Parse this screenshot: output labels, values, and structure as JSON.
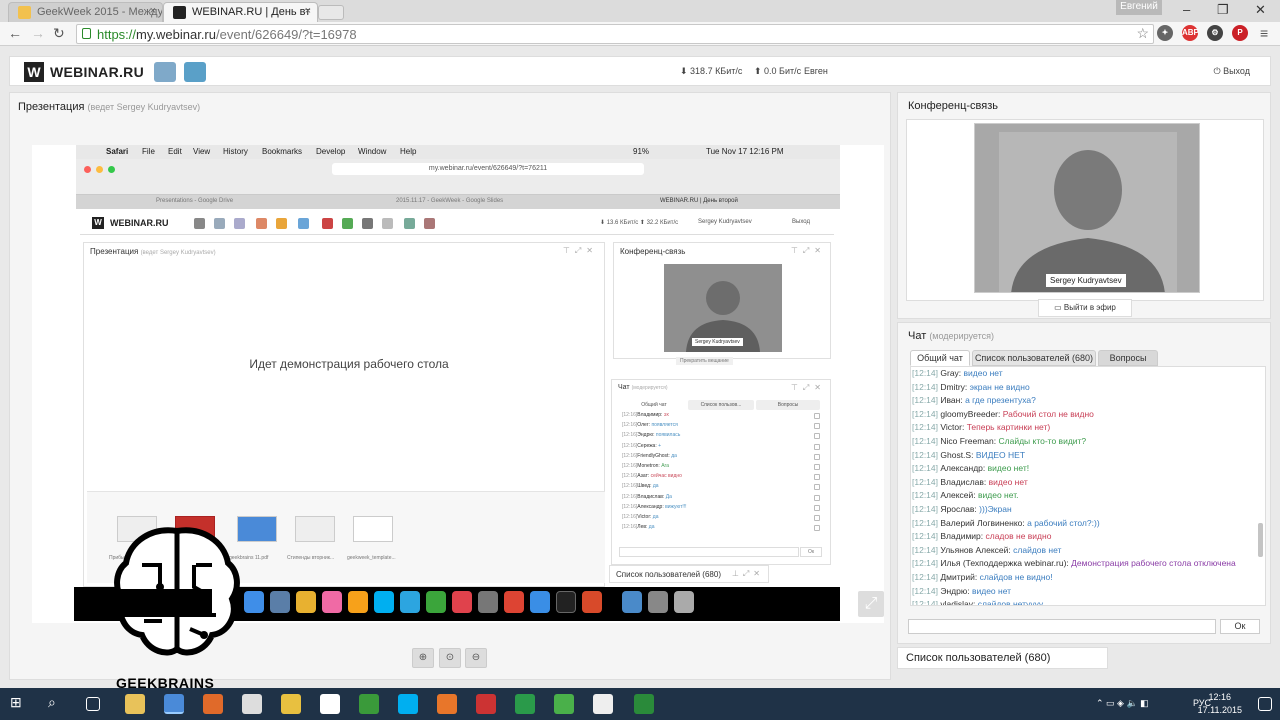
{
  "browser": {
    "tabs": [
      {
        "title": "GeekWeek 2015 - Между",
        "active": false
      },
      {
        "title": "WEBINAR.RU | День вт",
        "active": true
      }
    ],
    "user_badge": "Евгений",
    "url_scheme": "https://",
    "url_host": "my.webinar.ru",
    "url_path": "/event/626649/?t=16978"
  },
  "header": {
    "logo_text": "WEBINAR.RU",
    "download": "318.7 КБит/с",
    "upload": "0.0 Бит/с",
    "user": "Евген",
    "logout": "Выход"
  },
  "presentation": {
    "title": "Презентация",
    "subtitle": "(ведет Sergey Kudryavtsev)"
  },
  "inner": {
    "mac_menu": [
      "Safari",
      "File",
      "Edit",
      "View",
      "History",
      "Bookmarks",
      "Develop",
      "Window",
      "Help"
    ],
    "mac_status": "91%",
    "mac_clock": "Tue Nov 17  12:16 PM",
    "url": "my.webinar.ru/event/626649/?t=76211",
    "tabs": [
      "Presentations - Google Drive",
      "2015.11.17 - GeekWeek - Google Slides",
      "WEBINAR.RU | День второй"
    ],
    "logo_text": "WEBINAR.RU",
    "stats": "⬇ 13.6 КБит/с  ⬆ 32.2 КБит/с",
    "user": "Sergey Kudryavtsev",
    "logout": "Выход",
    "pres_title": "Презентация",
    "pres_sub": "(ведет Sergey Kudryavtsev)",
    "pres_msg": "Идет демонстрация рабочего стола",
    "thumbs": [
      "Прибыль...",
      "",
      "geekbrains 11.pdf",
      "Стипенды вторник...",
      "geekweek_template..."
    ],
    "conf_title": "Конференц-связь",
    "conf_name": "Sergey Kudryavtsev",
    "conf_stop": "Прекратить вещание",
    "chat_title": "Чат",
    "chat_sub": "(модерируется)",
    "chat_tabs": [
      "Общий чат",
      "Список пользов...",
      "Вопросы"
    ],
    "chat_lines": [
      {
        "t": "[12:16]",
        "a": "Владимир:",
        "m": "эх",
        "c": "red"
      },
      {
        "t": "[12:16]",
        "a": "Олег:",
        "m": "появляется",
        "c": ""
      },
      {
        "t": "[12:16]",
        "a": "Эндрю:",
        "m": "появилась",
        "c": ""
      },
      {
        "t": "[12:16]",
        "a": "Сережа:",
        "m": "+",
        "c": ""
      },
      {
        "t": "[12:16]",
        "a": "FriendlyGhost:",
        "m": "да",
        "c": ""
      },
      {
        "t": "[12:16]",
        "a": "Monetron:",
        "m": "Ага",
        "c": "grn"
      },
      {
        "t": "[12:16]",
        "a": "Азат:",
        "m": "сейчас видно",
        "c": "red"
      },
      {
        "t": "[12:16]",
        "a": "Швед:",
        "m": "да",
        "c": ""
      },
      {
        "t": "[12:16]",
        "a": "Владислав:",
        "m": "Да",
        "c": ""
      },
      {
        "t": "[12:16]",
        "a": "Александр:",
        "m": "вижуют!!!",
        "c": ""
      },
      {
        "t": "[12:16]",
        "a": "Victor:",
        "m": "да",
        "c": ""
      },
      {
        "t": "[12:16]",
        "a": "Лев:",
        "m": "да",
        "c": ""
      }
    ],
    "ok": "Ок",
    "users": "Список пользователей (680)"
  },
  "conference": {
    "title": "Конференц-связь",
    "speaker": "Sergey Kudryavtsev",
    "onair": "Выйти в эфир"
  },
  "chat": {
    "title": "Чат",
    "subtitle": "(модерируется)",
    "tabs": [
      "Общий чат",
      "Список пользователей (680)",
      "Вопросы"
    ],
    "messages": [
      {
        "t": "[12:14]",
        "a": "Gray:",
        "m": "видео нет",
        "c": ""
      },
      {
        "t": "[12:14]",
        "a": "Dmitry:",
        "m": "экран не видно",
        "c": ""
      },
      {
        "t": "[12:14]",
        "a": "Иван:",
        "m": "а где презентуха?",
        "c": ""
      },
      {
        "t": "[12:14]",
        "a": "gloomyBreeder:",
        "m": "Рабочий стол не видно",
        "c": "red"
      },
      {
        "t": "[12:14]",
        "a": "Victor:",
        "m": "Теперь картинки нет)",
        "c": "red"
      },
      {
        "t": "[12:14]",
        "a": "Nico Freeman:",
        "m": "Слайды кто-то видит?",
        "c": "grn"
      },
      {
        "t": "[12:14]",
        "a": "Ghost.S:",
        "m": "ВИДЕО НЕТ",
        "c": ""
      },
      {
        "t": "[12:14]",
        "a": "Александр:",
        "m": "видео нет!",
        "c": "grn"
      },
      {
        "t": "[12:14]",
        "a": "Владислав:",
        "m": "видео нет",
        "c": "red"
      },
      {
        "t": "[12:14]",
        "a": "Алексей:",
        "m": "видео нет.",
        "c": "grn"
      },
      {
        "t": "[12:14]",
        "a": "Ярослав:",
        "m": ")))Экран",
        "c": ""
      },
      {
        "t": "[12:14]",
        "a": "Валерий Логвиненко:",
        "m": "а рабочий стол?:))",
        "c": ""
      },
      {
        "t": "[12:14]",
        "a": "Владимир:",
        "m": "сладов не видно",
        "c": "red"
      },
      {
        "t": "[12:14]",
        "a": "Ульянов Алексей:",
        "m": "слайдов нет",
        "c": ""
      },
      {
        "t": "[12:14]",
        "a": "Илья (Техподдержка webinar.ru):",
        "m": "Демонстрация рабочего стола отключена",
        "c": "pur"
      },
      {
        "t": "[12:14]",
        "a": "Дмитрий:",
        "m": "слайдов не видно!",
        "c": ""
      },
      {
        "t": "[12:14]",
        "a": "Эндрю:",
        "m": "видео нет",
        "c": ""
      },
      {
        "t": "[12:14]",
        "a": "vladislav:",
        "m": "слайдов нетуууу",
        "c": ""
      }
    ],
    "ok": "Ок",
    "users": "Список пользователей (680)"
  },
  "watermark": "GEEKBRAINS",
  "taskbar": {
    "lang": "РУС",
    "time": "12:16",
    "date": "17.11.2015"
  },
  "colors": {
    "brand": "#222222",
    "link": "#3b7dbf",
    "taskbar": "#1f3247"
  }
}
